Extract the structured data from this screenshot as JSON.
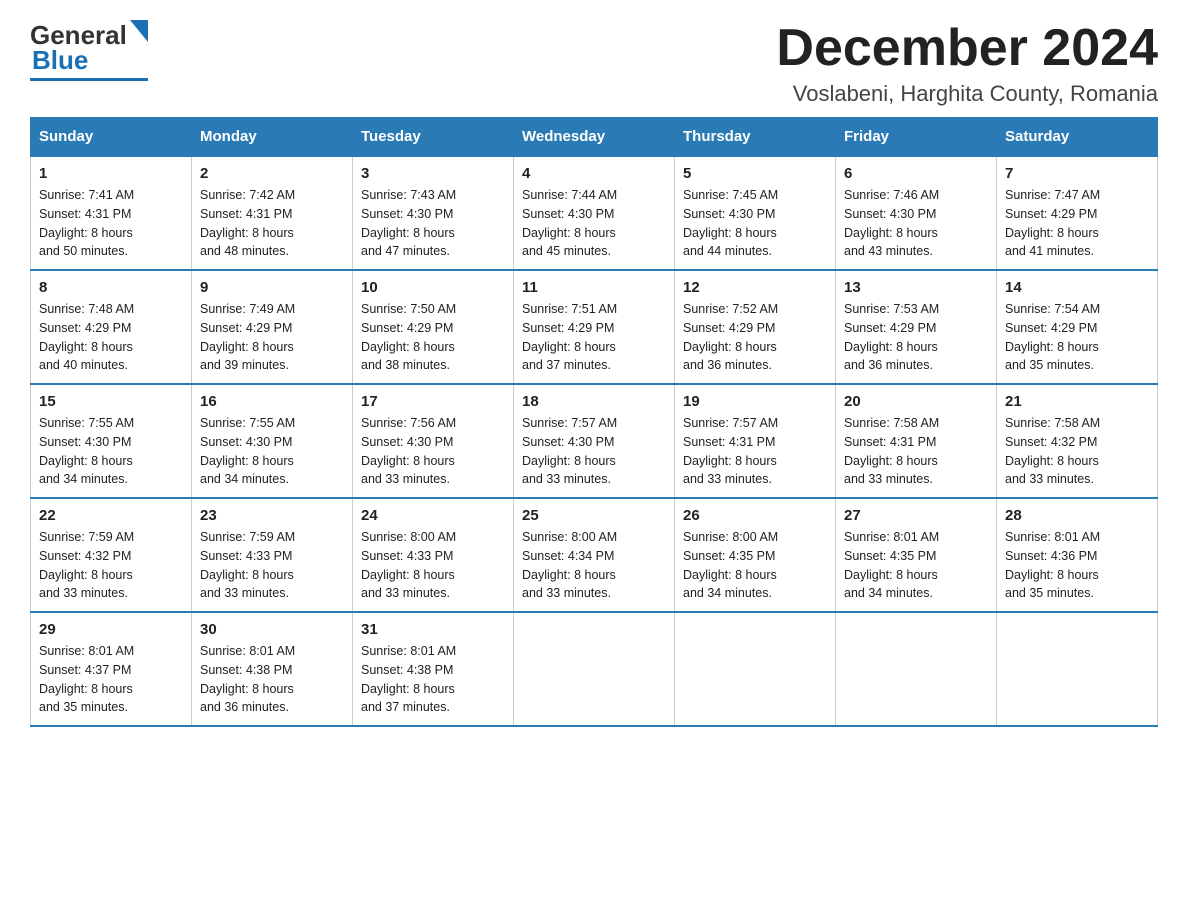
{
  "header": {
    "month_title": "December 2024",
    "location": "Voslabeni, Harghita County, Romania",
    "logo_general": "General",
    "logo_blue": "Blue"
  },
  "weekdays": [
    "Sunday",
    "Monday",
    "Tuesday",
    "Wednesday",
    "Thursday",
    "Friday",
    "Saturday"
  ],
  "weeks": [
    [
      {
        "day": "1",
        "sunrise": "7:41 AM",
        "sunset": "4:31 PM",
        "daylight": "8 hours and 50 minutes."
      },
      {
        "day": "2",
        "sunrise": "7:42 AM",
        "sunset": "4:31 PM",
        "daylight": "8 hours and 48 minutes."
      },
      {
        "day": "3",
        "sunrise": "7:43 AM",
        "sunset": "4:30 PM",
        "daylight": "8 hours and 47 minutes."
      },
      {
        "day": "4",
        "sunrise": "7:44 AM",
        "sunset": "4:30 PM",
        "daylight": "8 hours and 45 minutes."
      },
      {
        "day": "5",
        "sunrise": "7:45 AM",
        "sunset": "4:30 PM",
        "daylight": "8 hours and 44 minutes."
      },
      {
        "day": "6",
        "sunrise": "7:46 AM",
        "sunset": "4:30 PM",
        "daylight": "8 hours and 43 minutes."
      },
      {
        "day": "7",
        "sunrise": "7:47 AM",
        "sunset": "4:29 PM",
        "daylight": "8 hours and 41 minutes."
      }
    ],
    [
      {
        "day": "8",
        "sunrise": "7:48 AM",
        "sunset": "4:29 PM",
        "daylight": "8 hours and 40 minutes."
      },
      {
        "day": "9",
        "sunrise": "7:49 AM",
        "sunset": "4:29 PM",
        "daylight": "8 hours and 39 minutes."
      },
      {
        "day": "10",
        "sunrise": "7:50 AM",
        "sunset": "4:29 PM",
        "daylight": "8 hours and 38 minutes."
      },
      {
        "day": "11",
        "sunrise": "7:51 AM",
        "sunset": "4:29 PM",
        "daylight": "8 hours and 37 minutes."
      },
      {
        "day": "12",
        "sunrise": "7:52 AM",
        "sunset": "4:29 PM",
        "daylight": "8 hours and 36 minutes."
      },
      {
        "day": "13",
        "sunrise": "7:53 AM",
        "sunset": "4:29 PM",
        "daylight": "8 hours and 36 minutes."
      },
      {
        "day": "14",
        "sunrise": "7:54 AM",
        "sunset": "4:29 PM",
        "daylight": "8 hours and 35 minutes."
      }
    ],
    [
      {
        "day": "15",
        "sunrise": "7:55 AM",
        "sunset": "4:30 PM",
        "daylight": "8 hours and 34 minutes."
      },
      {
        "day": "16",
        "sunrise": "7:55 AM",
        "sunset": "4:30 PM",
        "daylight": "8 hours and 34 minutes."
      },
      {
        "day": "17",
        "sunrise": "7:56 AM",
        "sunset": "4:30 PM",
        "daylight": "8 hours and 33 minutes."
      },
      {
        "day": "18",
        "sunrise": "7:57 AM",
        "sunset": "4:30 PM",
        "daylight": "8 hours and 33 minutes."
      },
      {
        "day": "19",
        "sunrise": "7:57 AM",
        "sunset": "4:31 PM",
        "daylight": "8 hours and 33 minutes."
      },
      {
        "day": "20",
        "sunrise": "7:58 AM",
        "sunset": "4:31 PM",
        "daylight": "8 hours and 33 minutes."
      },
      {
        "day": "21",
        "sunrise": "7:58 AM",
        "sunset": "4:32 PM",
        "daylight": "8 hours and 33 minutes."
      }
    ],
    [
      {
        "day": "22",
        "sunrise": "7:59 AM",
        "sunset": "4:32 PM",
        "daylight": "8 hours and 33 minutes."
      },
      {
        "day": "23",
        "sunrise": "7:59 AM",
        "sunset": "4:33 PM",
        "daylight": "8 hours and 33 minutes."
      },
      {
        "day": "24",
        "sunrise": "8:00 AM",
        "sunset": "4:33 PM",
        "daylight": "8 hours and 33 minutes."
      },
      {
        "day": "25",
        "sunrise": "8:00 AM",
        "sunset": "4:34 PM",
        "daylight": "8 hours and 33 minutes."
      },
      {
        "day": "26",
        "sunrise": "8:00 AM",
        "sunset": "4:35 PM",
        "daylight": "8 hours and 34 minutes."
      },
      {
        "day": "27",
        "sunrise": "8:01 AM",
        "sunset": "4:35 PM",
        "daylight": "8 hours and 34 minutes."
      },
      {
        "day": "28",
        "sunrise": "8:01 AM",
        "sunset": "4:36 PM",
        "daylight": "8 hours and 35 minutes."
      }
    ],
    [
      {
        "day": "29",
        "sunrise": "8:01 AM",
        "sunset": "4:37 PM",
        "daylight": "8 hours and 35 minutes."
      },
      {
        "day": "30",
        "sunrise": "8:01 AM",
        "sunset": "4:38 PM",
        "daylight": "8 hours and 36 minutes."
      },
      {
        "day": "31",
        "sunrise": "8:01 AM",
        "sunset": "4:38 PM",
        "daylight": "8 hours and 37 minutes."
      },
      {
        "day": "",
        "sunrise": "",
        "sunset": "",
        "daylight": ""
      },
      {
        "day": "",
        "sunrise": "",
        "sunset": "",
        "daylight": ""
      },
      {
        "day": "",
        "sunrise": "",
        "sunset": "",
        "daylight": ""
      },
      {
        "day": "",
        "sunrise": "",
        "sunset": "",
        "daylight": ""
      }
    ]
  ],
  "labels": {
    "sunrise": "Sunrise: ",
    "sunset": "Sunset: ",
    "daylight": "Daylight: "
  }
}
